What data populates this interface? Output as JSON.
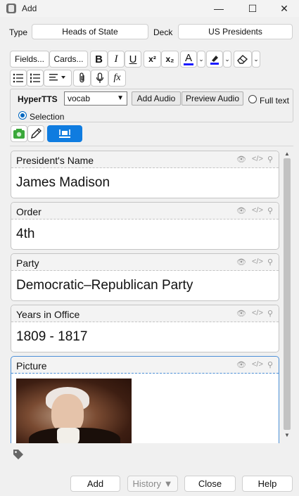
{
  "window": {
    "title": "Add",
    "minimize_glyph": "—",
    "maximize_glyph": "☐",
    "close_glyph": "✕"
  },
  "note_type": {
    "type_label": "Type",
    "type_value": "Heads of State",
    "deck_label": "Deck",
    "deck_value": "US Presidents"
  },
  "toolbar": {
    "fields_label": "Fields...",
    "cards_label": "Cards...",
    "bold": "B",
    "italic": "I",
    "underline": "U",
    "superscript": "x²",
    "subscript": "x₂",
    "text_color_glyph": "A",
    "text_color": "#1a1aff",
    "highlight_color": "#1a1aff",
    "function_glyph": "fx"
  },
  "hypertts": {
    "title": "HyperTTS",
    "preset_value": "vocab",
    "add_audio_label": "Add Audio",
    "preview_audio_label": "Preview Audio",
    "full_text_label": "Full text",
    "selection_label": "Selection",
    "selected_mode": "Selection"
  },
  "fields": [
    {
      "name": "President's Name",
      "value": "James Madison"
    },
    {
      "name": "Order",
      "value": "4th"
    },
    {
      "name": "Party",
      "value": "Democratic–Republican Party"
    },
    {
      "name": "Years in Office",
      "value": "1809 - 1817"
    },
    {
      "name": "Picture",
      "value": ""
    }
  ],
  "buttons": {
    "add": "Add",
    "history": "History ▼",
    "close": "Close",
    "help": "Help"
  },
  "colors": {
    "accent": "#0f7ce0",
    "active_field_border": "#4c8fd6"
  }
}
